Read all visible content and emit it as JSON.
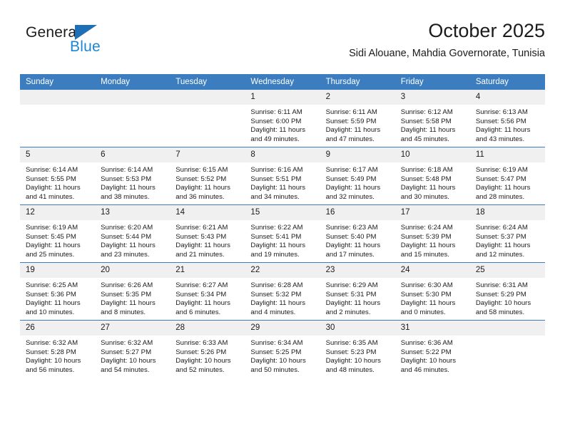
{
  "brand": {
    "name_top": "General",
    "name_bottom": "Blue",
    "triangle_color": "#1d6fb8",
    "blue_text_color": "#1b86d4"
  },
  "header": {
    "month_title": "October 2025",
    "location": "Sidi Alouane, Mahdia Governorate, Tunisia"
  },
  "theme": {
    "header_row_bg": "#3b7dbf",
    "daynum_bg": "#f0f0f0",
    "text_color": "#1b1b1b",
    "page_bg": "#ffffff"
  },
  "weekday_headers": [
    "Sunday",
    "Monday",
    "Tuesday",
    "Wednesday",
    "Thursday",
    "Friday",
    "Saturday"
  ],
  "weeks": [
    {
      "days": [
        {
          "day": "",
          "empty": true,
          "sunrise": "",
          "sunset": "",
          "daylight_line1": "",
          "daylight_line2": ""
        },
        {
          "day": "",
          "empty": true,
          "sunrise": "",
          "sunset": "",
          "daylight_line1": "",
          "daylight_line2": ""
        },
        {
          "day": "",
          "empty": true,
          "sunrise": "",
          "sunset": "",
          "daylight_line1": "",
          "daylight_line2": ""
        },
        {
          "day": "1",
          "empty": false,
          "sunrise": "Sunrise: 6:11 AM",
          "sunset": "Sunset: 6:00 PM",
          "daylight_line1": "Daylight: 11 hours",
          "daylight_line2": "and 49 minutes."
        },
        {
          "day": "2",
          "empty": false,
          "sunrise": "Sunrise: 6:11 AM",
          "sunset": "Sunset: 5:59 PM",
          "daylight_line1": "Daylight: 11 hours",
          "daylight_line2": "and 47 minutes."
        },
        {
          "day": "3",
          "empty": false,
          "sunrise": "Sunrise: 6:12 AM",
          "sunset": "Sunset: 5:58 PM",
          "daylight_line1": "Daylight: 11 hours",
          "daylight_line2": "and 45 minutes."
        },
        {
          "day": "4",
          "empty": false,
          "sunrise": "Sunrise: 6:13 AM",
          "sunset": "Sunset: 5:56 PM",
          "daylight_line1": "Daylight: 11 hours",
          "daylight_line2": "and 43 minutes."
        }
      ]
    },
    {
      "days": [
        {
          "day": "5",
          "empty": false,
          "sunrise": "Sunrise: 6:14 AM",
          "sunset": "Sunset: 5:55 PM",
          "daylight_line1": "Daylight: 11 hours",
          "daylight_line2": "and 41 minutes."
        },
        {
          "day": "6",
          "empty": false,
          "sunrise": "Sunrise: 6:14 AM",
          "sunset": "Sunset: 5:53 PM",
          "daylight_line1": "Daylight: 11 hours",
          "daylight_line2": "and 38 minutes."
        },
        {
          "day": "7",
          "empty": false,
          "sunrise": "Sunrise: 6:15 AM",
          "sunset": "Sunset: 5:52 PM",
          "daylight_line1": "Daylight: 11 hours",
          "daylight_line2": "and 36 minutes."
        },
        {
          "day": "8",
          "empty": false,
          "sunrise": "Sunrise: 6:16 AM",
          "sunset": "Sunset: 5:51 PM",
          "daylight_line1": "Daylight: 11 hours",
          "daylight_line2": "and 34 minutes."
        },
        {
          "day": "9",
          "empty": false,
          "sunrise": "Sunrise: 6:17 AM",
          "sunset": "Sunset: 5:49 PM",
          "daylight_line1": "Daylight: 11 hours",
          "daylight_line2": "and 32 minutes."
        },
        {
          "day": "10",
          "empty": false,
          "sunrise": "Sunrise: 6:18 AM",
          "sunset": "Sunset: 5:48 PM",
          "daylight_line1": "Daylight: 11 hours",
          "daylight_line2": "and 30 minutes."
        },
        {
          "day": "11",
          "empty": false,
          "sunrise": "Sunrise: 6:19 AM",
          "sunset": "Sunset: 5:47 PM",
          "daylight_line1": "Daylight: 11 hours",
          "daylight_line2": "and 28 minutes."
        }
      ]
    },
    {
      "days": [
        {
          "day": "12",
          "empty": false,
          "sunrise": "Sunrise: 6:19 AM",
          "sunset": "Sunset: 5:45 PM",
          "daylight_line1": "Daylight: 11 hours",
          "daylight_line2": "and 25 minutes."
        },
        {
          "day": "13",
          "empty": false,
          "sunrise": "Sunrise: 6:20 AM",
          "sunset": "Sunset: 5:44 PM",
          "daylight_line1": "Daylight: 11 hours",
          "daylight_line2": "and 23 minutes."
        },
        {
          "day": "14",
          "empty": false,
          "sunrise": "Sunrise: 6:21 AM",
          "sunset": "Sunset: 5:43 PM",
          "daylight_line1": "Daylight: 11 hours",
          "daylight_line2": "and 21 minutes."
        },
        {
          "day": "15",
          "empty": false,
          "sunrise": "Sunrise: 6:22 AM",
          "sunset": "Sunset: 5:41 PM",
          "daylight_line1": "Daylight: 11 hours",
          "daylight_line2": "and 19 minutes."
        },
        {
          "day": "16",
          "empty": false,
          "sunrise": "Sunrise: 6:23 AM",
          "sunset": "Sunset: 5:40 PM",
          "daylight_line1": "Daylight: 11 hours",
          "daylight_line2": "and 17 minutes."
        },
        {
          "day": "17",
          "empty": false,
          "sunrise": "Sunrise: 6:24 AM",
          "sunset": "Sunset: 5:39 PM",
          "daylight_line1": "Daylight: 11 hours",
          "daylight_line2": "and 15 minutes."
        },
        {
          "day": "18",
          "empty": false,
          "sunrise": "Sunrise: 6:24 AM",
          "sunset": "Sunset: 5:37 PM",
          "daylight_line1": "Daylight: 11 hours",
          "daylight_line2": "and 12 minutes."
        }
      ]
    },
    {
      "days": [
        {
          "day": "19",
          "empty": false,
          "sunrise": "Sunrise: 6:25 AM",
          "sunset": "Sunset: 5:36 PM",
          "daylight_line1": "Daylight: 11 hours",
          "daylight_line2": "and 10 minutes."
        },
        {
          "day": "20",
          "empty": false,
          "sunrise": "Sunrise: 6:26 AM",
          "sunset": "Sunset: 5:35 PM",
          "daylight_line1": "Daylight: 11 hours",
          "daylight_line2": "and 8 minutes."
        },
        {
          "day": "21",
          "empty": false,
          "sunrise": "Sunrise: 6:27 AM",
          "sunset": "Sunset: 5:34 PM",
          "daylight_line1": "Daylight: 11 hours",
          "daylight_line2": "and 6 minutes."
        },
        {
          "day": "22",
          "empty": false,
          "sunrise": "Sunrise: 6:28 AM",
          "sunset": "Sunset: 5:32 PM",
          "daylight_line1": "Daylight: 11 hours",
          "daylight_line2": "and 4 minutes."
        },
        {
          "day": "23",
          "empty": false,
          "sunrise": "Sunrise: 6:29 AM",
          "sunset": "Sunset: 5:31 PM",
          "daylight_line1": "Daylight: 11 hours",
          "daylight_line2": "and 2 minutes."
        },
        {
          "day": "24",
          "empty": false,
          "sunrise": "Sunrise: 6:30 AM",
          "sunset": "Sunset: 5:30 PM",
          "daylight_line1": "Daylight: 11 hours",
          "daylight_line2": "and 0 minutes."
        },
        {
          "day": "25",
          "empty": false,
          "sunrise": "Sunrise: 6:31 AM",
          "sunset": "Sunset: 5:29 PM",
          "daylight_line1": "Daylight: 10 hours",
          "daylight_line2": "and 58 minutes."
        }
      ]
    },
    {
      "days": [
        {
          "day": "26",
          "empty": false,
          "sunrise": "Sunrise: 6:32 AM",
          "sunset": "Sunset: 5:28 PM",
          "daylight_line1": "Daylight: 10 hours",
          "daylight_line2": "and 56 minutes."
        },
        {
          "day": "27",
          "empty": false,
          "sunrise": "Sunrise: 6:32 AM",
          "sunset": "Sunset: 5:27 PM",
          "daylight_line1": "Daylight: 10 hours",
          "daylight_line2": "and 54 minutes."
        },
        {
          "day": "28",
          "empty": false,
          "sunrise": "Sunrise: 6:33 AM",
          "sunset": "Sunset: 5:26 PM",
          "daylight_line1": "Daylight: 10 hours",
          "daylight_line2": "and 52 minutes."
        },
        {
          "day": "29",
          "empty": false,
          "sunrise": "Sunrise: 6:34 AM",
          "sunset": "Sunset: 5:25 PM",
          "daylight_line1": "Daylight: 10 hours",
          "daylight_line2": "and 50 minutes."
        },
        {
          "day": "30",
          "empty": false,
          "sunrise": "Sunrise: 6:35 AM",
          "sunset": "Sunset: 5:23 PM",
          "daylight_line1": "Daylight: 10 hours",
          "daylight_line2": "and 48 minutes."
        },
        {
          "day": "31",
          "empty": false,
          "sunrise": "Sunrise: 6:36 AM",
          "sunset": "Sunset: 5:22 PM",
          "daylight_line1": "Daylight: 10 hours",
          "daylight_line2": "and 46 minutes."
        },
        {
          "day": "",
          "empty": true,
          "sunrise": "",
          "sunset": "",
          "daylight_line1": "",
          "daylight_line2": ""
        }
      ]
    }
  ]
}
